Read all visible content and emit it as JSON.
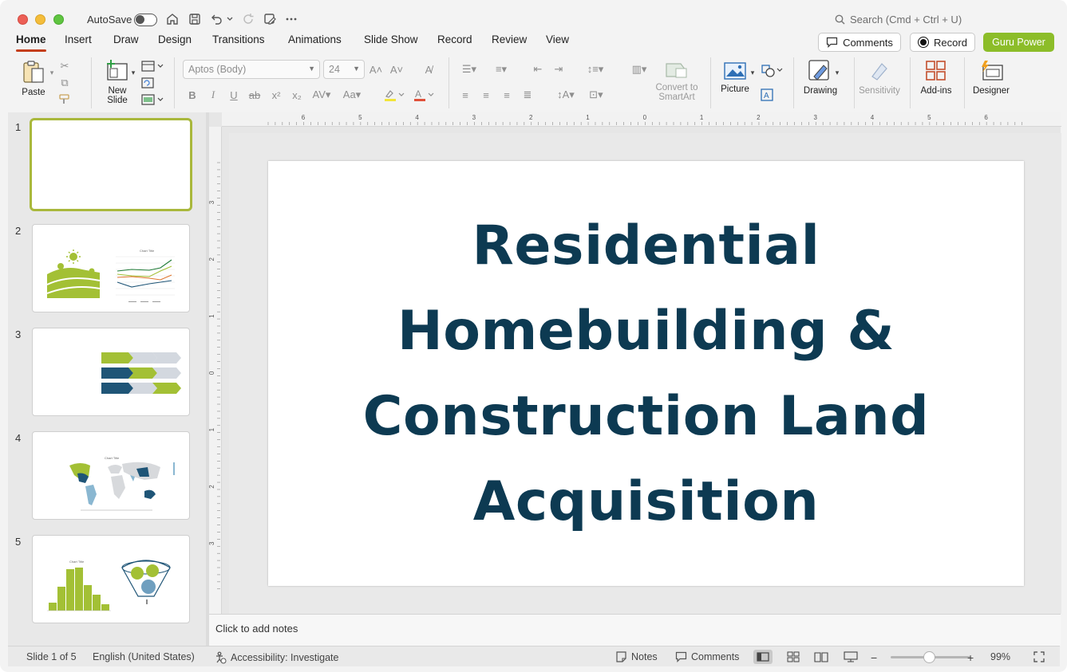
{
  "titlebar": {
    "autosave_label": "AutoSave",
    "search_placeholder": "Search (Cmd + Ctrl + U)"
  },
  "menu": {
    "tabs": [
      "Home",
      "Insert",
      "Draw",
      "Design",
      "Transitions",
      "Animations",
      "Slide Show",
      "Record",
      "Review",
      "View"
    ],
    "active_tab": "Home",
    "comments_label": "Comments",
    "record_label": "Record",
    "guru_label": "Guru Power"
  },
  "ribbon": {
    "paste_label": "Paste",
    "new_slide_label_1": "New",
    "new_slide_label_2": "Slide",
    "font_name": "Aptos (Body)",
    "font_size": "24",
    "smartart_label_1": "Convert to",
    "smartart_label_2": "SmartArt",
    "picture_label": "Picture",
    "drawing_label": "Drawing",
    "sensitivity_label": "Sensitivity",
    "addins_label": "Add-ins",
    "designer_label": "Designer"
  },
  "slides_panel": {
    "numbers": [
      "1",
      "2",
      "3",
      "4",
      "5"
    ],
    "thumb2_chart_title": "Chart Title",
    "thumb4_chart_title": "Chart Title",
    "thumb5_chart_title": "Chart Title"
  },
  "ruler": {
    "h_labels": [
      "6",
      "5",
      "4",
      "3",
      "2",
      "1",
      "0",
      "1",
      "2",
      "3",
      "4",
      "5",
      "6"
    ],
    "v_labels": [
      "3",
      "2",
      "1",
      "0",
      "1",
      "2",
      "3"
    ]
  },
  "slide": {
    "title": "Residential Homebuilding & Construction Land Acquisition"
  },
  "notes": {
    "placeholder": "Click to add notes"
  },
  "status": {
    "slide_count": "Slide 1 of 5",
    "language": "English (United States)",
    "accessibility": "Accessibility: Investigate",
    "notes_label": "Notes",
    "comments_label": "Comments",
    "zoom_minus": "−",
    "zoom_plus": "+",
    "zoom_level": "99%"
  },
  "colors": {
    "accent_tab": "#c43e1c",
    "guru_button": "#8cbd29",
    "slide_title": "#0d3a52",
    "selected_thumb_border": "#a9b83c",
    "thumb_green": "#a3c035",
    "thumb_navy": "#1f5577"
  }
}
